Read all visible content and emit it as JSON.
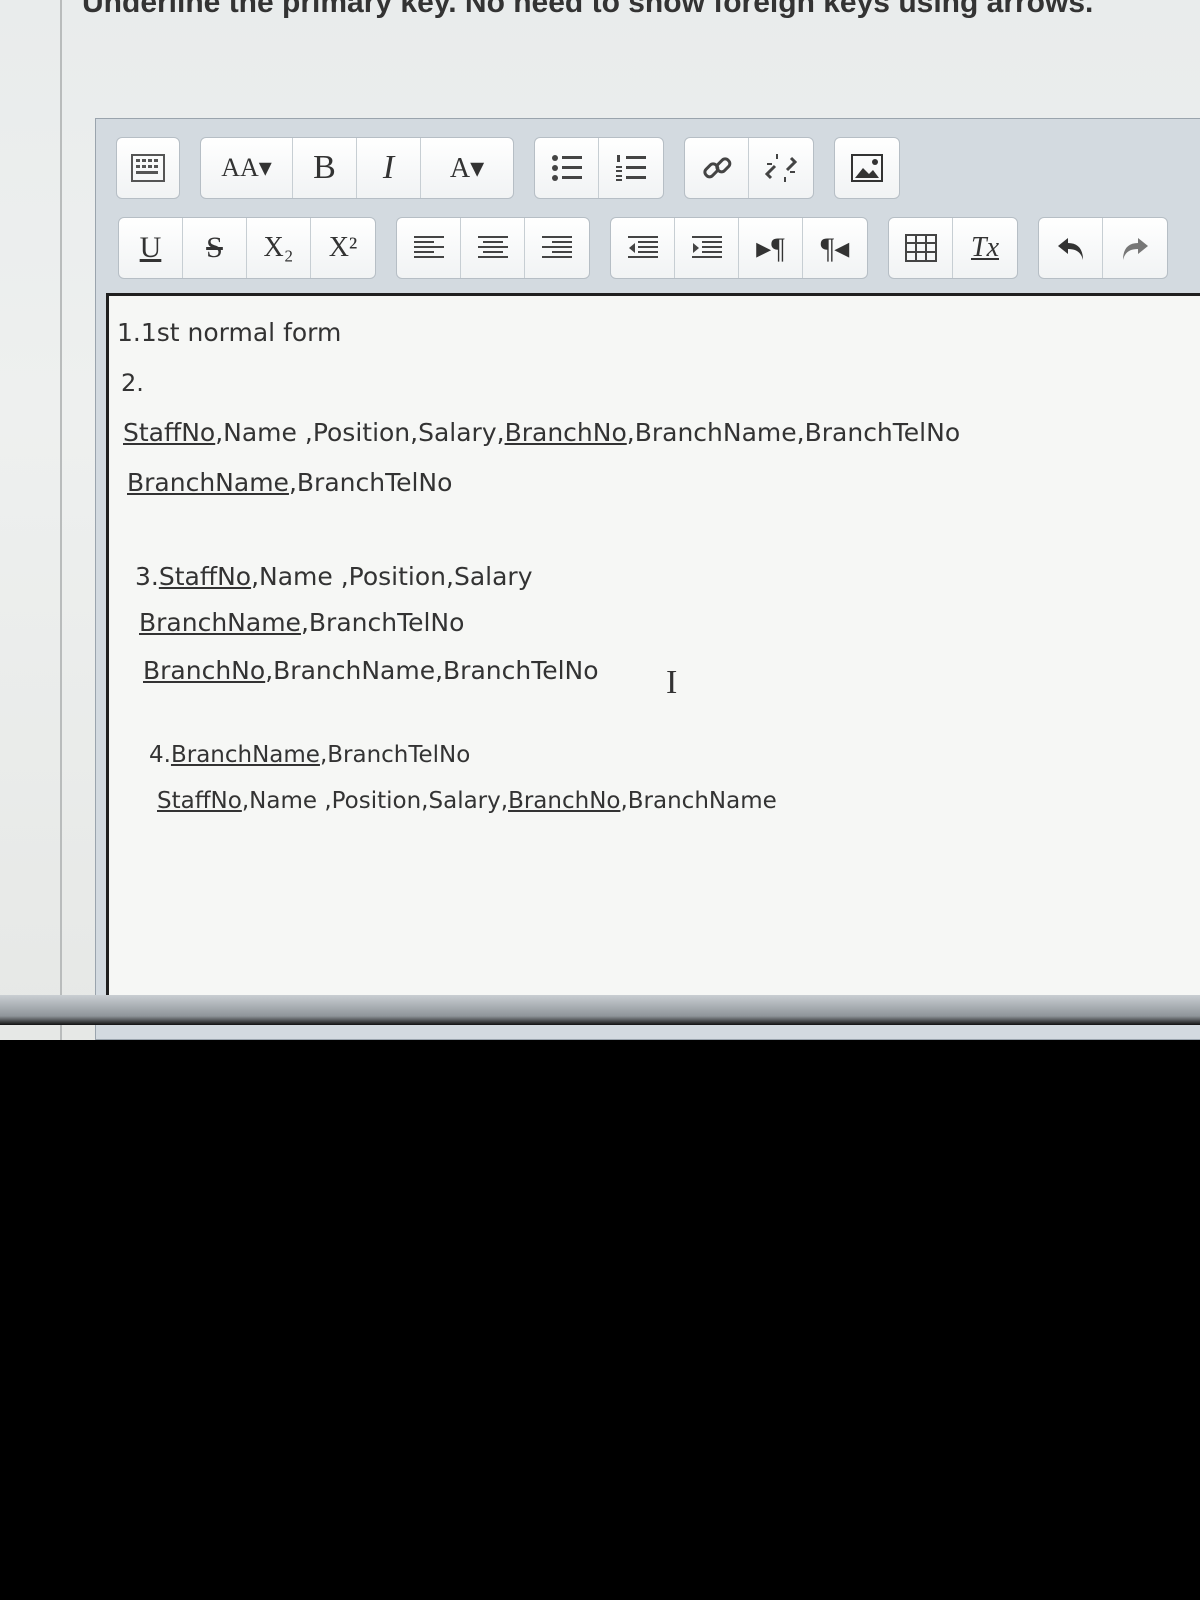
{
  "instruction_text": "Underline the primary key. No need to show foreign keys using arrows.",
  "toolbar": {
    "row1": [
      {
        "name": "toolbar-toggle-button",
        "icon": "keyboard-icon"
      },
      {
        "name": "font-size-button",
        "label": "AA▾",
        "icon": "font-size-icon"
      },
      {
        "name": "bold-button",
        "label": "B"
      },
      {
        "name": "italic-button",
        "label": "I"
      },
      {
        "name": "font-color-button",
        "label": "A▾"
      },
      {
        "name": "bulleted-list-button",
        "icon": "bulleted-list-icon"
      },
      {
        "name": "numbered-list-button",
        "icon": "numbered-list-icon"
      },
      {
        "name": "insert-link-button",
        "icon": "link-icon"
      },
      {
        "name": "remove-link-button",
        "icon": "unlink-icon"
      },
      {
        "name": "insert-image-button",
        "icon": "image-icon"
      }
    ],
    "row2": [
      {
        "name": "underline-button",
        "label": "U"
      },
      {
        "name": "strikethrough-button",
        "label": "S"
      },
      {
        "name": "subscript-button",
        "label": "X₂"
      },
      {
        "name": "superscript-button",
        "label": "X²"
      },
      {
        "name": "align-left-button",
        "icon": "align-left-icon"
      },
      {
        "name": "align-center-button",
        "icon": "align-center-icon"
      },
      {
        "name": "align-right-button",
        "icon": "align-right-icon"
      },
      {
        "name": "decrease-indent-button",
        "icon": "outdent-icon"
      },
      {
        "name": "increase-indent-button",
        "icon": "indent-icon"
      },
      {
        "name": "ltr-button",
        "label": "▸¶"
      },
      {
        "name": "rtl-button",
        "label": "¶◂"
      },
      {
        "name": "insert-table-button",
        "icon": "table-icon"
      },
      {
        "name": "clear-formatting-button",
        "label": "Tx"
      },
      {
        "name": "undo-button",
        "icon": "undo-icon"
      },
      {
        "name": "redo-button",
        "icon": "redo-icon"
      }
    ]
  },
  "editor": {
    "lines": [
      {
        "id": "l1",
        "parts": [
          {
            "t": "1.1st normal form",
            "u": false
          }
        ]
      },
      {
        "id": "l2",
        "parts": [
          {
            "t": "2.",
            "u": false
          }
        ]
      },
      {
        "id": "l3",
        "parts": [
          {
            "t": "StaffNo",
            "u": true
          },
          {
            "t": ",Name ,Position,Salary,",
            "u": false
          },
          {
            "t": "BranchNo",
            "u": true
          },
          {
            "t": ",BranchName,BranchTelNo",
            "u": false
          }
        ]
      },
      {
        "id": "l4",
        "parts": [
          {
            "t": "BranchName",
            "u": true
          },
          {
            "t": ",BranchTelNo",
            "u": false
          }
        ]
      },
      {
        "id": "l5",
        "parts": [
          {
            "t": "3.",
            "u": false
          },
          {
            "t": "StaffNo",
            "u": true
          },
          {
            "t": ",Name ,Position,Salary",
            "u": false
          }
        ]
      },
      {
        "id": "l6",
        "parts": [
          {
            "t": "BranchName",
            "u": true
          },
          {
            "t": ",BranchTelNo",
            "u": false
          }
        ]
      },
      {
        "id": "l7",
        "parts": [
          {
            "t": "BranchNo",
            "u": true
          },
          {
            "t": ",BranchName,BranchTelNo",
            "u": false
          }
        ]
      },
      {
        "id": "l8",
        "parts": [
          {
            "t": "4.",
            "u": false
          },
          {
            "t": "BranchName",
            "u": true
          },
          {
            "t": ",BranchTelNo",
            "u": false
          }
        ]
      },
      {
        "id": "l9",
        "parts": [
          {
            "t": "StaffNo",
            "u": true
          },
          {
            "t": ",Name ,Position,Salary,",
            "u": false
          },
          {
            "t": "BranchNo",
            "u": true
          },
          {
            "t": ",BranchName",
            "u": false
          }
        ]
      }
    ],
    "cursor_glyph": "I"
  }
}
